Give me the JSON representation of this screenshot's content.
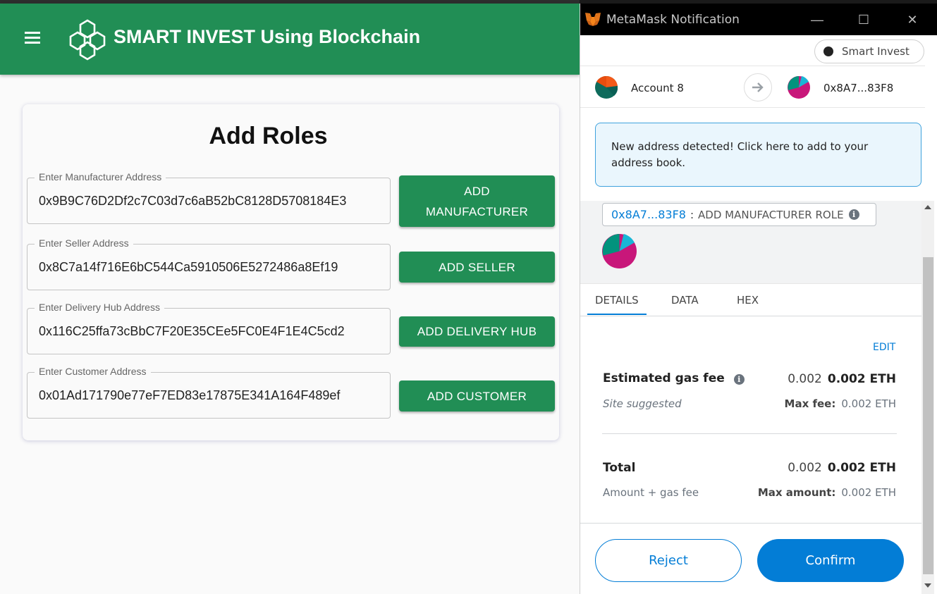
{
  "app": {
    "title": "SMART INVEST Using Blockchain",
    "brand_color": "#218e55",
    "card_title": "Add Roles",
    "fields": [
      {
        "label": "Enter Manufacturer Address",
        "value": "0x9B9C76D2Df2c7C03d7c6aB52bC8128D5708184E3",
        "button_line1": "ADD",
        "button_line2": "MANUFACTURER"
      },
      {
        "label": "Enter Seller Address",
        "value": "0x8C7a14f716E6bC544Ca5910506E5272486a8Ef19",
        "button": "ADD SELLER"
      },
      {
        "label": "Enter Delivery Hub Address",
        "value": "0x116C25ffa73cBbC7F20E35CEe5FC0E4F1E4C5cd2",
        "button": "ADD DELIVERY HUB"
      },
      {
        "label": "Enter Customer Address",
        "value": "0x01Ad171790e77eF7ED83e17875E341A164F489ef",
        "button": "ADD CUSTOMER"
      }
    ]
  },
  "metamask": {
    "window_title": "MetaMask Notification",
    "network": "Smart Invest",
    "from_account": "Account 8",
    "to_address": "0x8A7...83F8",
    "notice": "New address detected! Click here to add to your address book.",
    "origin_address": "0x8A7...83F8",
    "origin_separator": ":",
    "method": "ADD MANUFACTURER ROLE",
    "tabs": [
      "DETAILS",
      "DATA",
      "HEX"
    ],
    "edit_label": "EDIT",
    "gas": {
      "label": "Estimated gas fee",
      "value": "0.002",
      "value_bold": "0.002 ETH",
      "sub_label": "Site suggested",
      "max_label": "Max fee:",
      "max_value": "0.002 ETH"
    },
    "total": {
      "label": "Total",
      "value": "0.002",
      "value_bold": "0.002 ETH",
      "sub_label": "Amount + gas fee",
      "max_label": "Max amount:",
      "max_value": "0.002 ETH"
    },
    "reject_label": "Reject",
    "confirm_label": "Confirm",
    "accent_color": "#037dd6"
  }
}
